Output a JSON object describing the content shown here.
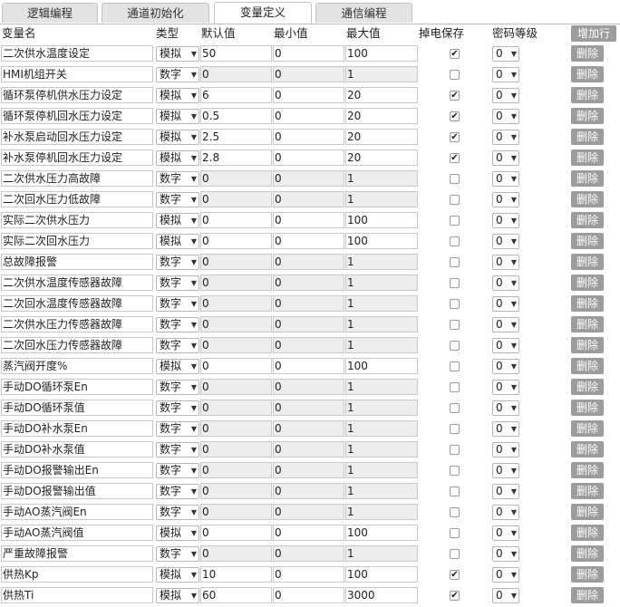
{
  "tabs": [
    {
      "label": "逻辑编程"
    },
    {
      "label": "通道初始化"
    },
    {
      "label": "变量定义",
      "active": true
    },
    {
      "label": "通信编程"
    }
  ],
  "table": {
    "headers": {
      "name": "变量名",
      "type": "类型",
      "default": "默认值",
      "min": "最小值",
      "max": "最大值",
      "retain": "掉电保存",
      "level": "密码等级"
    },
    "add_row_label": "增加行",
    "delete_label": "删除",
    "rows": [
      {
        "name": "二次供水温度设定",
        "type": "模拟",
        "default": "50",
        "min": "0",
        "max": "100",
        "retain": true,
        "level": "0"
      },
      {
        "name": "HMI机组开关",
        "type": "数字",
        "default": "0",
        "min": "0",
        "max": "1",
        "retain": false,
        "level": "0"
      },
      {
        "name": "循环泵停机供水压力设定",
        "type": "模拟",
        "default": "6",
        "min": "0",
        "max": "20",
        "retain": true,
        "level": "0"
      },
      {
        "name": "循环泵停机回水压力设定",
        "type": "模拟",
        "default": "0.5",
        "min": "0",
        "max": "20",
        "retain": true,
        "level": "0"
      },
      {
        "name": "补水泵启动回水压力设定",
        "type": "模拟",
        "default": "2.5",
        "min": "0",
        "max": "20",
        "retain": true,
        "level": "0"
      },
      {
        "name": "补水泵停机回水压力设定",
        "type": "模拟",
        "default": "2.8",
        "min": "0",
        "max": "20",
        "retain": true,
        "level": "0"
      },
      {
        "name": "二次供水压力高故障",
        "type": "数字",
        "default": "0",
        "min": "0",
        "max": "1",
        "retain": false,
        "level": "0"
      },
      {
        "name": "二次回水压力低故障",
        "type": "数字",
        "default": "0",
        "min": "0",
        "max": "1",
        "retain": false,
        "level": "0"
      },
      {
        "name": "实际二次供水压力",
        "type": "模拟",
        "default": "0",
        "min": "0",
        "max": "100",
        "retain": false,
        "level": "0"
      },
      {
        "name": "实际二次回水压力",
        "type": "模拟",
        "default": "0",
        "min": "0",
        "max": "100",
        "retain": false,
        "level": "0"
      },
      {
        "name": "总故障报警",
        "type": "数字",
        "default": "0",
        "min": "0",
        "max": "1",
        "retain": false,
        "level": "0"
      },
      {
        "name": "二次供水温度传感器故障",
        "type": "数字",
        "default": "0",
        "min": "0",
        "max": "1",
        "retain": false,
        "level": "0"
      },
      {
        "name": "二次回水温度传感器故障",
        "type": "数字",
        "default": "0",
        "min": "0",
        "max": "1",
        "retain": false,
        "level": "0"
      },
      {
        "name": "二次供水压力传感器故障",
        "type": "数字",
        "default": "0",
        "min": "0",
        "max": "1",
        "retain": false,
        "level": "0"
      },
      {
        "name": "二次回水压力传感器故障",
        "type": "数字",
        "default": "0",
        "min": "0",
        "max": "1",
        "retain": false,
        "level": "0"
      },
      {
        "name": "蒸汽阀开度%",
        "type": "模拟",
        "default": "0",
        "min": "0",
        "max": "100",
        "retain": false,
        "level": "0"
      },
      {
        "name": "手动DO循环泵En",
        "type": "数字",
        "default": "0",
        "min": "0",
        "max": "1",
        "retain": false,
        "level": "0"
      },
      {
        "name": "手动DO循环泵值",
        "type": "数字",
        "default": "0",
        "min": "0",
        "max": "1",
        "retain": false,
        "level": "0"
      },
      {
        "name": "手动DO补水泵En",
        "type": "数字",
        "default": "0",
        "min": "0",
        "max": "1",
        "retain": false,
        "level": "0"
      },
      {
        "name": "手动DO补水泵值",
        "type": "数字",
        "default": "0",
        "min": "0",
        "max": "1",
        "retain": false,
        "level": "0"
      },
      {
        "name": "手动DO报警输出En",
        "type": "数字",
        "default": "0",
        "min": "0",
        "max": "1",
        "retain": false,
        "level": "0"
      },
      {
        "name": "手动DO报警输出值",
        "type": "数字",
        "default": "0",
        "min": "0",
        "max": "1",
        "retain": false,
        "level": "0"
      },
      {
        "name": "手动AO蒸汽阀En",
        "type": "数字",
        "default": "0",
        "min": "0",
        "max": "1",
        "retain": false,
        "level": "0"
      },
      {
        "name": "手动AO蒸汽阀值",
        "type": "模拟",
        "default": "0",
        "min": "0",
        "max": "100",
        "retain": false,
        "level": "0"
      },
      {
        "name": "严重故障报警",
        "type": "数字",
        "default": "0",
        "min": "0",
        "max": "1",
        "retain": false,
        "level": "0"
      },
      {
        "name": "供热Kp",
        "type": "模拟",
        "default": "10",
        "min": "0",
        "max": "100",
        "retain": true,
        "level": "0"
      },
      {
        "name": "供热Ti",
        "type": "模拟",
        "default": "60",
        "min": "0",
        "max": "3000",
        "retain": true,
        "level": "0"
      }
    ]
  },
  "colors": {
    "active_tab": "#ffffff",
    "inactive_tab": "#e3e3e3",
    "button_gray": "#9c9c9c"
  }
}
